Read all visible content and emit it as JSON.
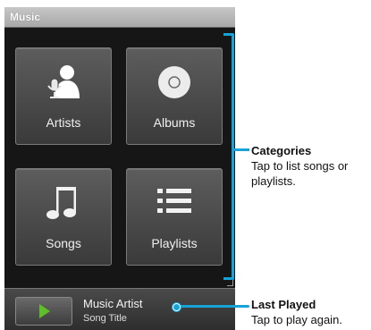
{
  "app": {
    "title": "Music"
  },
  "tiles": [
    {
      "label": "Artists",
      "icon": "artist-icon"
    },
    {
      "label": "Albums",
      "icon": "album-disc-icon"
    },
    {
      "label": "Songs",
      "icon": "music-note-icon"
    },
    {
      "label": "Playlists",
      "icon": "playlist-icon"
    }
  ],
  "now_playing": {
    "artist": "Music Artist",
    "song": "Song Title",
    "play_icon": "play-icon"
  },
  "callouts": {
    "categories": {
      "title": "Categories",
      "body": "Tap to list songs or playlists."
    },
    "last_played": {
      "title": "Last Played",
      "body": "Tap to play again."
    }
  },
  "colors": {
    "callout_accent": "#16a3d8",
    "play_green": "#5fbf2a",
    "screen_bg": "#161616"
  }
}
